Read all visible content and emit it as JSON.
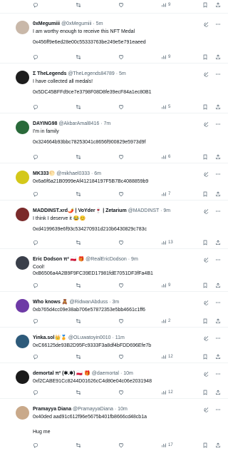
{
  "colors": {
    "text": "#0f1419",
    "muted": "#536471",
    "divider": "#eff3f4"
  },
  "top_actions": {
    "views": "9"
  },
  "posts": [
    {
      "name": "0xMegumiii",
      "handle": "@0xMegumiii",
      "time": "· 5m",
      "lines": [
        "I am worthy enough to receive this NFT Medal",
        "",
        "0x456ff9e6ed28e00c55333763be249e5e791eaeed"
      ],
      "views": "9",
      "avatar_color": "#c9b8a9",
      "avatar": "anime-girl-avatar"
    },
    {
      "name": "Σ TheLegends",
      "handle": "@TheLegends84789",
      "time": "· 5m",
      "lines": [
        "I have collected all medals!",
        "",
        "0x5DC45BFFd9ce7e3798F08D8fe39ecF84a1ec80B1"
      ],
      "views": "5",
      "avatar_color": "#1d1d1d",
      "avatar": "dark-logo-avatar"
    },
    {
      "name": "DAYING98",
      "handle": "@AkbarAmal8416",
      "time": "· 7m",
      "lines": [
        "I'm in family",
        "",
        "0x324664b93bbc78253041c8656f900829e5973d9f"
      ],
      "views": "6",
      "avatar_color": "#2a6a3a",
      "avatar": "green-avatar"
    },
    {
      "name": "MK333🌕",
      "handle": "@mikhael0333",
      "time": "· 6m",
      "lines": [
        "0x6a6f6a21B0999eAf412184197F5B7Bc4088859b9"
      ],
      "views": "7",
      "avatar_color": "#d4c81a",
      "avatar": "yellow-avatar"
    },
    {
      "name": "MADDINST.xrd🌶️ | VoYder🍷 | Zetarium",
      "handle": "@MADDINST",
      "time": "· 9m",
      "lines": [
        "I think I deserve it 😂😊",
        "",
        "0xd4199639e6f93c534270931d210b6430829c783c"
      ],
      "views": "13",
      "avatar_color": "#7b2b2b",
      "avatar": "red-character-avatar"
    },
    {
      "name": "Eric Dodson π² 🇵🇱 🎁",
      "handle": "@RealEricDodson",
      "time": "· 9m",
      "lines": [
        "Cool!",
        "0xB6506a4A2B9F9FC39ED17981fdE7051DF3fFa4B1"
      ],
      "views": "9",
      "avatar_color": "#3a3f4a",
      "avatar": "man-avatar"
    },
    {
      "name": "Who knows 🧸",
      "handle": "@RidwanAbduss",
      "time": "· 3m",
      "lines": [
        "0xb765d4cc09e38ab706e57872353e5bb4661c1ff6"
      ],
      "views": "2",
      "avatar_color": "#6e3aa6",
      "avatar": "purple-avatar"
    },
    {
      "name": "Yinka.sol👑🏅",
      "handle": "@OLuwatoyin0010",
      "time": "· 11m",
      "lines": [
        "0xC66125de93B2D95Fc9333F3a8df4bFDD696Efe7b"
      ],
      "views": "12",
      "avatar_color": "#2d5a7a",
      "avatar": "blue-avatar"
    },
    {
      "name": "demortal π² (✱.✱) 🇵🇱 🎁",
      "handle": "@daemortal",
      "time": "· 10m",
      "lines": [
        "0xf2CABE91Cc8244D01626cC4d80e04c06e2031948"
      ],
      "views": "12",
      "avatar_color": "#1a1a1a",
      "avatar": "black-avatar"
    },
    {
      "name": "Pramayya Diana",
      "handle": "@PramayyaDiana",
      "time": "· 10m",
      "lines": [
        "0x40ded aad91c612f96e5675b401fb8666cd48cb1a",
        "",
        "",
        "Hug me"
      ],
      "views": "17",
      "avatar_color": "#c9a98a",
      "avatar": "woman-avatar"
    }
  ]
}
